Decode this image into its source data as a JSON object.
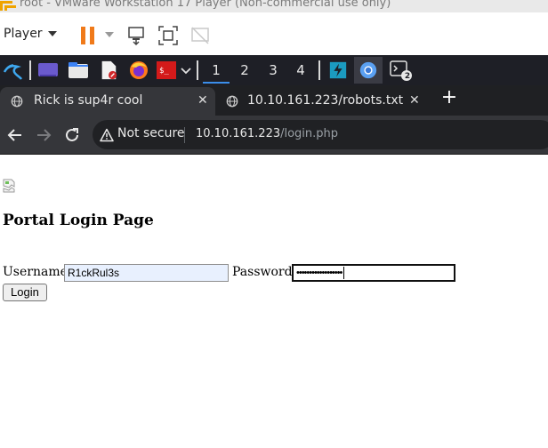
{
  "vmware": {
    "title": "root - VMware Workstation 17 Player (Non-commercial use only)",
    "player_menu": "Player"
  },
  "taskbar": {
    "workspaces": [
      "1",
      "2",
      "3",
      "4"
    ],
    "active_workspace": "1",
    "terminal_badge": "2"
  },
  "browser": {
    "tabs": [
      {
        "title": "Rick is sup4r cool",
        "active": true
      },
      {
        "title": "10.10.161.223/robots.txt",
        "active": false
      }
    ],
    "new_tab_label": "+",
    "security_label": "Not secure",
    "url_host": "10.10.161.223",
    "url_path": "/login.php"
  },
  "page": {
    "heading": "Portal Login Page",
    "username_label": "Username:",
    "username_value": "R1ckRul3s",
    "password_label": "Password:",
    "password_mask": "••••••••••••••••••",
    "login_button": "Login"
  },
  "colors": {
    "vmware_accent": "#f07a1a",
    "taskbar_bg": "#1e1f26",
    "tabstrip_bg": "#1f2023",
    "active_tab_bg": "#35363a",
    "omnibox_bg": "#202124",
    "autofill_bg": "#e8f0fe"
  }
}
